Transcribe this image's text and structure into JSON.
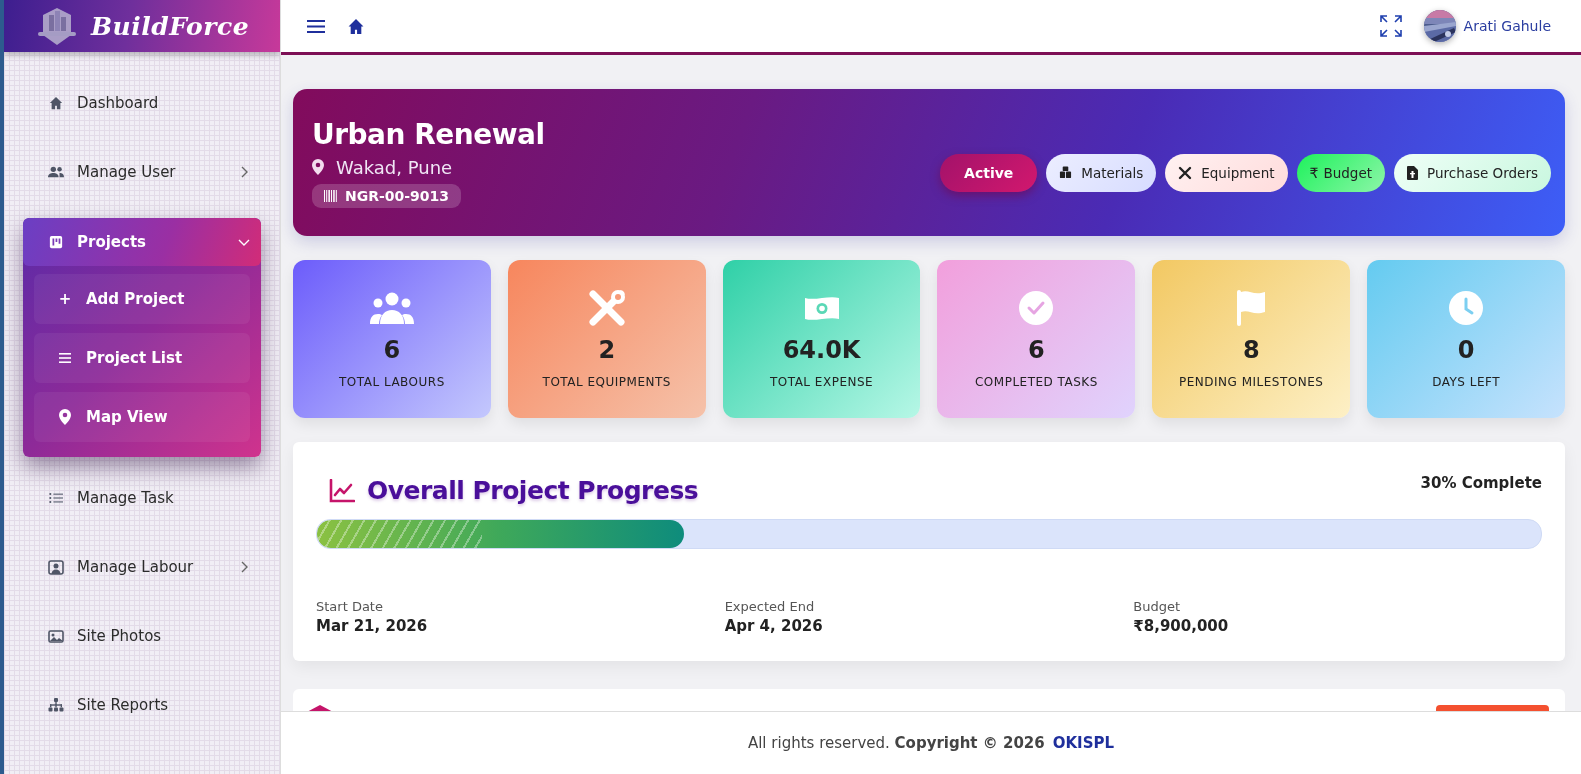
{
  "brand": {
    "name": "BuildForce"
  },
  "sidebar": {
    "items": [
      {
        "label": "Dashboard"
      },
      {
        "label": "Manage User",
        "expanded": false
      },
      {
        "label": "Projects",
        "expanded": true,
        "children": [
          {
            "label": "Add Project",
            "symbol": "+"
          },
          {
            "label": "Project List"
          },
          {
            "label": "Map View"
          }
        ]
      },
      {
        "label": "Manage Task"
      },
      {
        "label": "Manage Labour",
        "expanded": false
      },
      {
        "label": "Site Photos"
      },
      {
        "label": "Site Reports"
      }
    ]
  },
  "header": {
    "user": "Arati Gahule"
  },
  "project": {
    "title": "Urban Renewal",
    "location": "Wakad, Pune",
    "code": "NGR-00-9013",
    "status": "Active",
    "actions": [
      {
        "label": "Materials"
      },
      {
        "label": "Equipment"
      },
      {
        "label": "Budget",
        "symbol": "₹"
      },
      {
        "label": "Purchase Orders"
      }
    ]
  },
  "stats": [
    {
      "value": "6",
      "label": "TOTAL LABOURS"
    },
    {
      "value": "2",
      "label": "TOTAL EQUIPMENTS"
    },
    {
      "value": "64.0K",
      "label": "TOTAL EXPENSE"
    },
    {
      "value": "6",
      "label": "COMPLETED TASKS"
    },
    {
      "value": "8",
      "label": "PENDING MILESTONES"
    },
    {
      "value": "0",
      "label": "DAYS LEFT"
    }
  ],
  "progress": {
    "title": "Overall Project Progress",
    "reading": "30% Complete",
    "level": 0.3,
    "details": [
      {
        "label": "Start Date",
        "value": "Mar 21, 2026"
      },
      {
        "label": "Expected End",
        "value": "Apr 4, 2026"
      },
      {
        "label": "Budget",
        "value": "₹8,900,000"
      }
    ]
  },
  "footer": {
    "text": "All rights reserved. **Copyright © 2026**",
    "link": "OKISPL"
  }
}
